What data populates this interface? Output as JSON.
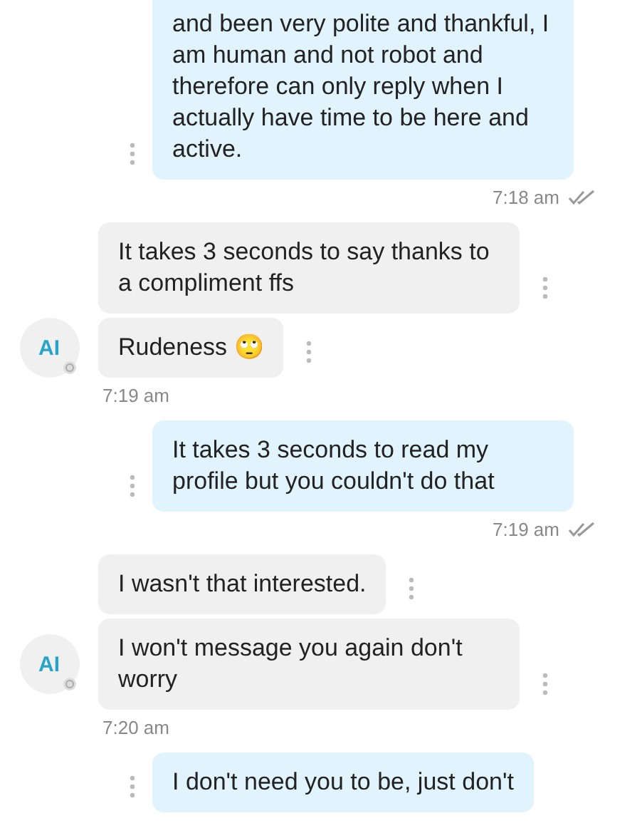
{
  "messages": [
    {
      "kind": "sent",
      "bubbles": [
        "and been very polite and thankful, I am human and not robot and therefore can only reply when I actually have time to be here and active."
      ],
      "time": "7:18 am",
      "read": true
    },
    {
      "kind": "received",
      "avatar": "AI",
      "bubbles": [
        "It takes 3 seconds to say thanks to a compliment ffs",
        "Rudeness 🙄"
      ],
      "time": "7:19 am"
    },
    {
      "kind": "sent",
      "bubbles": [
        "It takes 3 seconds to read my profile but you couldn't do that"
      ],
      "time": "7:19 am",
      "read": true
    },
    {
      "kind": "received",
      "avatar": "AI",
      "bubbles": [
        "I wasn't that interested.",
        "I won't message you again don't worry"
      ],
      "time": "7:20 am"
    },
    {
      "kind": "sent",
      "bubbles": [
        "I don't need you to be, just don't"
      ]
    }
  ]
}
